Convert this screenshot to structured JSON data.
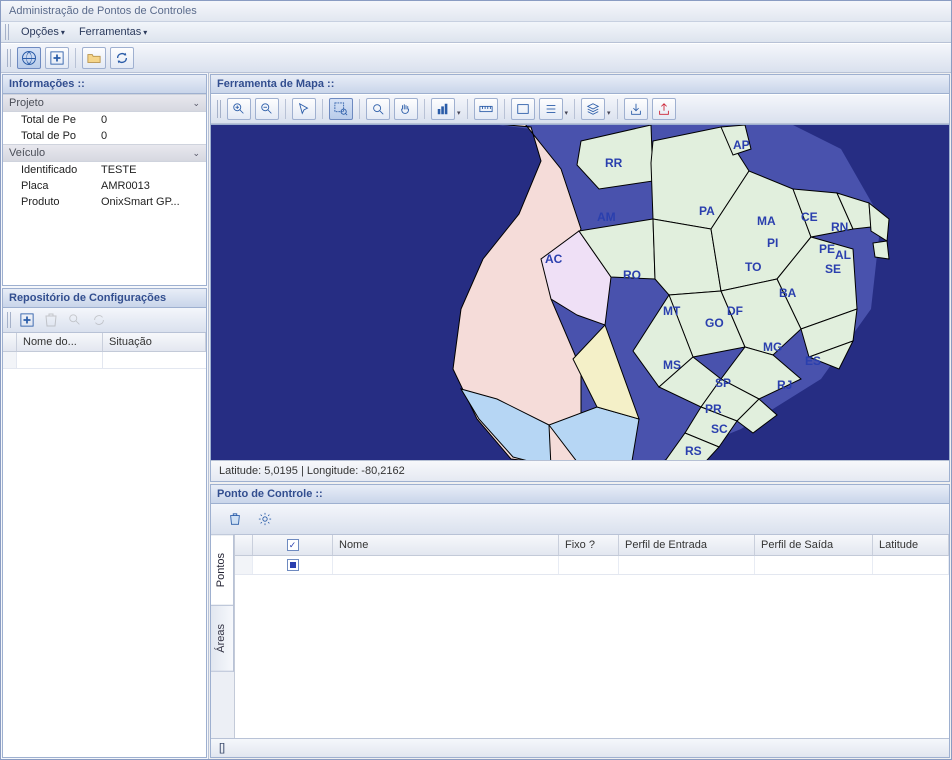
{
  "window": {
    "title": "Administração de Pontos de Controles"
  },
  "menubar": {
    "items": [
      "Opções",
      "Ferramentas"
    ]
  },
  "left": {
    "info": {
      "title": "Informações ::",
      "sections": [
        {
          "title": "Projeto",
          "rows": [
            {
              "k": "Total de Pe",
              "v": "0"
            },
            {
              "k": "Total de Po",
              "v": "0"
            }
          ]
        },
        {
          "title": "Veículo",
          "rows": [
            {
              "k": "Identificado",
              "v": "TESTE"
            },
            {
              "k": "Placa",
              "v": "AMR0013"
            },
            {
              "k": "Produto",
              "v": "OnixSmart GP..."
            }
          ]
        }
      ]
    },
    "repo": {
      "title": "Repositório de Configurações",
      "columns": [
        "Nome do...",
        "Situação"
      ]
    }
  },
  "map": {
    "title": "Ferramenta de Mapa ::",
    "coords": "Latitude: 5,0195 | Longitude: -80,2162",
    "states": [
      "RR",
      "AP",
      "AM",
      "PA",
      "MA",
      "CE",
      "RN",
      "PI",
      "PE",
      "AL",
      "SE",
      "AC",
      "RO",
      "TO",
      "MT",
      "BA",
      "DF",
      "GO",
      "MG",
      "MS",
      "ES",
      "SP",
      "RJ",
      "PR",
      "SC",
      "RS"
    ]
  },
  "pc": {
    "title": "Ponto de Controle ::",
    "tabs": [
      "Pontos",
      "Áreas"
    ],
    "columns": [
      "",
      "",
      "Nome",
      "Fixo ?",
      "Perfil de Entrada",
      "Perfil de Saída",
      "Latitude"
    ]
  },
  "status": {
    "text": "[]"
  }
}
